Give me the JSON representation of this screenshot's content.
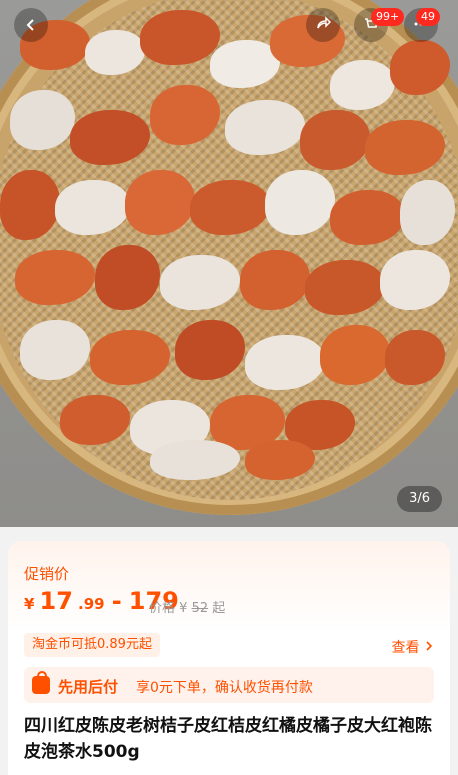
{
  "gallery": {
    "back_icon": "chevron-left-icon",
    "share_icon": "share-icon",
    "cart_icon": "cart-icon",
    "cart_badge": "99+",
    "more_badge": "49",
    "pager": "3/6"
  },
  "product": {
    "promo_label": "促销价",
    "price_symbol": "¥",
    "price_low_int": "17",
    "price_low_dec": ".99",
    "price_dash": "-",
    "price_high": "179",
    "original_label": "价格",
    "original_symbol": "¥",
    "original_price": "52",
    "original_suffix": "起",
    "coin_text": "淘金币可抵0.89元起",
    "view_label": "查看",
    "pay_title": "先用后付",
    "pay_desc": "享0元下单，确认收货再付款",
    "title": "四川红皮陈皮老树桔子皮红桔皮红橘皮橘子皮大红袍陈皮泡茶水500g"
  },
  "colors": {
    "accent": "#ff5000",
    "badge": "#ff2a1f"
  }
}
